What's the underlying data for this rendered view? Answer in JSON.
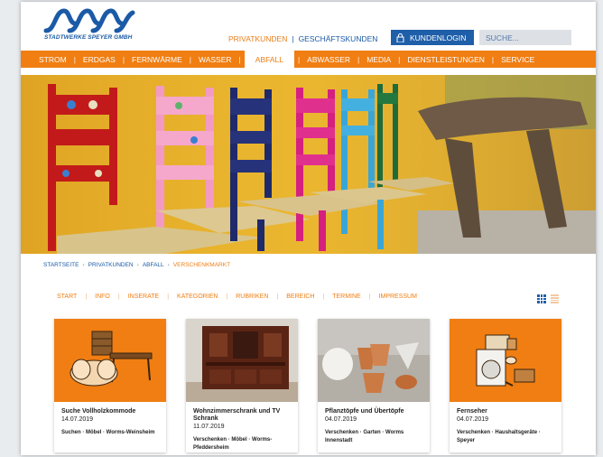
{
  "header": {
    "logo_text": "STADTWERKE SPEYER GMBH",
    "audience_private": "PRIVATKUNDEN",
    "audience_separator": "|",
    "audience_business": "GESCHÄFTSKUNDEN",
    "login_label": "KUNDENLOGIN",
    "search_placeholder": "SUCHE..."
  },
  "mainnav": {
    "items": [
      "STROM",
      "ERDGAS",
      "FERNWÄRME",
      "WASSER",
      "ABFALL",
      "ABWASSER",
      "MEDIA",
      "DIENSTLEISTUNGEN",
      "SERVICE"
    ],
    "separator": "|",
    "active": "ABFALL"
  },
  "breadcrumb": {
    "items": [
      "STARTSEITE",
      "PRIVATKUNDEN",
      "ABFALL",
      "VERSCHENKMARKT"
    ],
    "separator": "›"
  },
  "subnav": {
    "items": [
      "START",
      "INFO",
      "INSERATE",
      "KATEGORIEN",
      "RUBRIKEN",
      "BEREICH",
      "TERMINE",
      "IMPRESSUM"
    ],
    "separator": "|"
  },
  "colors": {
    "brand_blue": "#1f5ea8",
    "brand_orange": "#f07e12"
  },
  "listings": [
    {
      "title": "Suche Vollholzkommode",
      "date": "14.07.2019",
      "tags": "Suchen · Möbel · Worms-Weinsheim",
      "image": "furniture-illustration"
    },
    {
      "title": "Wohnzimmerschrank und TV Schrank",
      "date": "11.07.2019",
      "tags": "Verschenken · Möbel · Worms-Pfeddersheim",
      "image": "wall-cabinet-photo"
    },
    {
      "title": "Pflanztöpfe und Übertöpfe",
      "date": "04.07.2019",
      "tags": "Verschenken · Garten · Worms Innenstadt",
      "image": "flower-pots-photo"
    },
    {
      "title": "Fernseher",
      "date": "04.07.2019",
      "tags": "Verschenken · Haushaltsgeräte · Speyer",
      "image": "appliances-illustration"
    }
  ]
}
